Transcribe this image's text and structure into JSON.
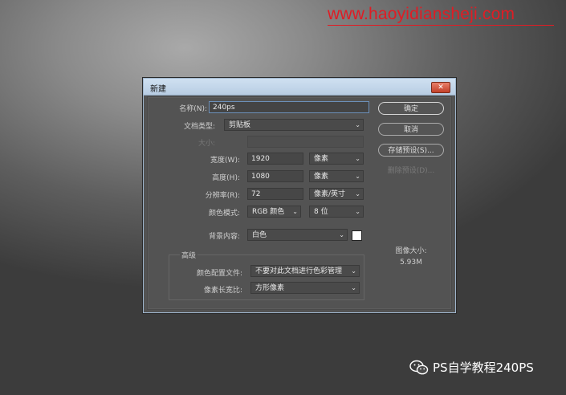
{
  "watermark": {
    "url": "www.haoyidiansheji.com"
  },
  "dialog": {
    "title": "新建",
    "close_label": "✕",
    "fields": {
      "name_label": "名称(N):",
      "name_value": "240ps",
      "doc_type_label": "文档类型:",
      "doc_type_value": "剪贴板",
      "size_label": "大小:",
      "width_label": "宽度(W):",
      "width_value": "1920",
      "width_unit": "像素",
      "height_label": "高度(H):",
      "height_value": "1080",
      "height_unit": "像素",
      "resolution_label": "分辨率(R):",
      "resolution_value": "72",
      "resolution_unit": "像素/英寸",
      "color_mode_label": "颜色模式:",
      "color_mode_value": "RGB 颜色",
      "bit_depth": "8 位",
      "bg_label": "背景内容:",
      "bg_value": "白色"
    },
    "advanced": {
      "title": "高级",
      "profile_label": "颜色配置文件:",
      "profile_value": "不要对此文档进行色彩管理",
      "pixel_aspect_label": "像素长宽比:",
      "pixel_aspect_value": "方形像素"
    },
    "buttons": {
      "ok": "确定",
      "cancel": "取消",
      "save_preset": "存储预设(S)...",
      "delete_preset": "删除预设(D)..."
    },
    "image_size": {
      "label": "图像大小:",
      "value": "5.93M"
    }
  },
  "wechat": {
    "account": "PS自学教程240PS"
  }
}
